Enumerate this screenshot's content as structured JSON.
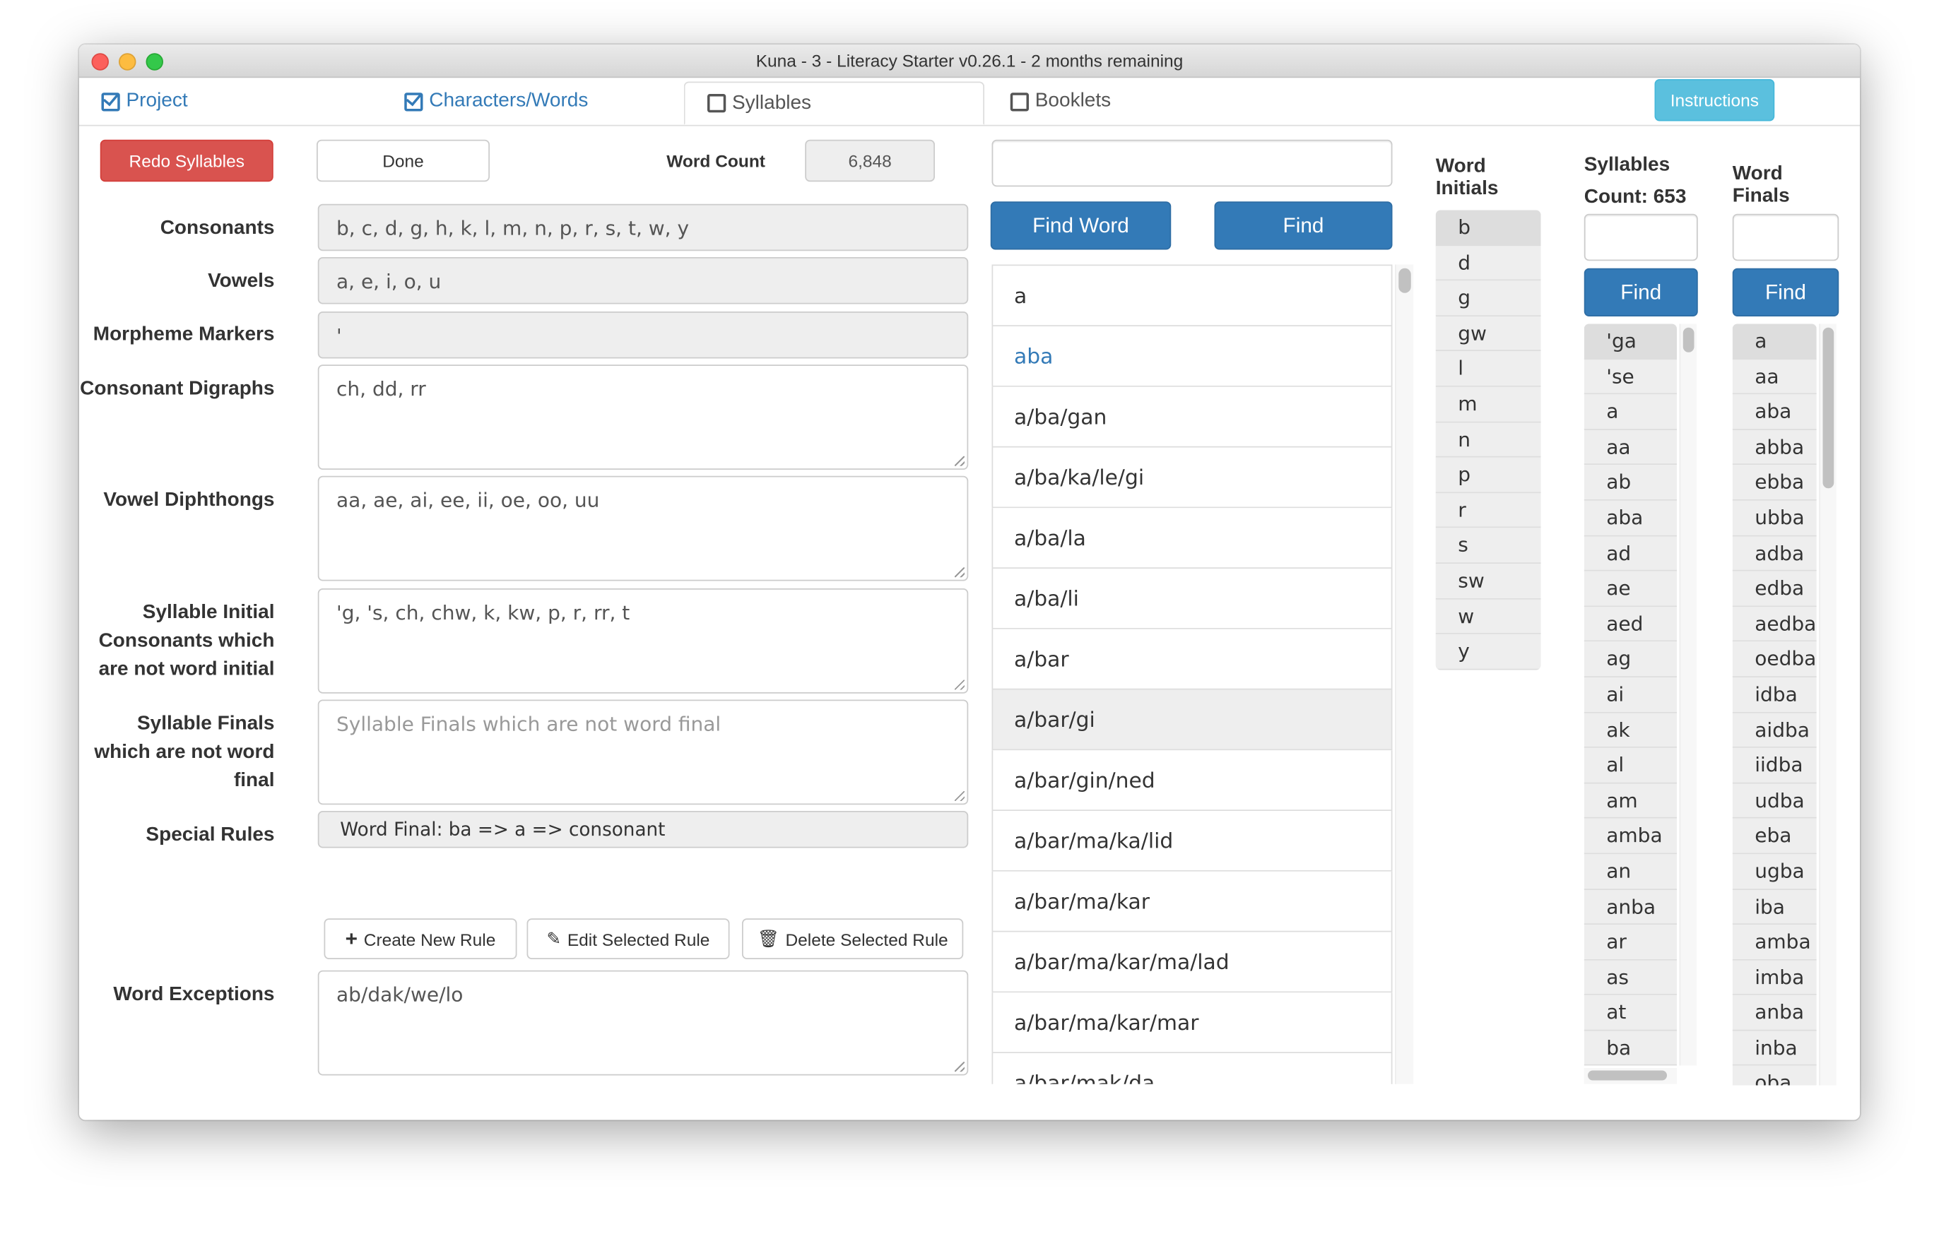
{
  "window": {
    "title": "Kuna - 3 - Literacy Starter v0.26.1 - 2 months remaining"
  },
  "tabs": [
    {
      "label": "Project",
      "checked": true
    },
    {
      "label": "Characters/Words",
      "checked": true
    },
    {
      "label": "Syllables",
      "checked": false,
      "active": true
    },
    {
      "label": "Booklets",
      "checked": false
    }
  ],
  "instructions_label": "Instructions",
  "toolbar": {
    "redo_label": "Redo Syllables",
    "done_label": "Done",
    "word_count_label": "Word Count",
    "word_count_value": "6,848"
  },
  "form": {
    "consonants": {
      "label": "Consonants",
      "value": "b, c, d, g, h, k, l, m, n, p, r, s, t, w, y"
    },
    "vowels": {
      "label": "Vowels",
      "value": "a, e, i, o, u"
    },
    "morpheme": {
      "label": "Morpheme Markers",
      "value": "'"
    },
    "digraphs": {
      "label": "Consonant Digraphs",
      "value": "ch, dd, rr"
    },
    "diphthongs": {
      "label": "Vowel Diphthongs",
      "value": "aa, ae, ai, ee, ii, oe, oo, uu"
    },
    "syl_initial": {
      "label": "Syllable Initial Consonants which are not word initial",
      "value": "'g, 's, ch, chw, k, kw, p, r, rr, t"
    },
    "syl_final": {
      "label": "Syllable Finals which are not word final",
      "placeholder": "Syllable Finals which are not word final",
      "value": ""
    },
    "special_rules": {
      "label": "Special Rules",
      "rule": "Word Final: ba => a => consonant"
    },
    "rule_buttons": {
      "create": "Create New Rule",
      "edit": "Edit Selected Rule",
      "delete": "Delete Selected Rule"
    },
    "exceptions": {
      "label": "Word Exceptions",
      "value": "ab/dak/we/lo"
    }
  },
  "words": {
    "search_value": "",
    "find_word_label": "Find Word",
    "find_label": "Find",
    "items": [
      "a",
      "aba",
      "a/ba/gan",
      "a/ba/ka/le/gi",
      "a/ba/la",
      "a/ba/li",
      "a/bar",
      "a/bar/gi",
      "a/bar/gin/ned",
      "a/bar/ma/ka/lid",
      "a/bar/ma/kar",
      "a/bar/ma/kar/ma/lad",
      "a/bar/ma/kar/mar",
      "a/bar/mak/da"
    ],
    "link_item": "aba",
    "selected_item": "a/bar/gi"
  },
  "word_initials": {
    "title": "Word Initials",
    "items": [
      "b",
      "d",
      "g",
      "gw",
      "l",
      "m",
      "n",
      "p",
      "r",
      "s",
      "sw",
      "w",
      "y"
    ],
    "selected_item": "b"
  },
  "syllables": {
    "title": "Syllables",
    "count_label": "Count: 653",
    "search_value": "",
    "find_label": "Find",
    "items": [
      "'ga",
      "'se",
      "a",
      "aa",
      "ab",
      "aba",
      "ad",
      "ae",
      "aed",
      "ag",
      "ai",
      "ak",
      "al",
      "am",
      "amba",
      "an",
      "anba",
      "ar",
      "as",
      "at",
      "ba"
    ],
    "selected_item": "'ga"
  },
  "word_finals": {
    "title": "Word Finals",
    "search_value": "",
    "find_label": "Find",
    "items": [
      "a",
      "aa",
      "aba",
      "abba",
      "ebba",
      "ubba",
      "adba",
      "edba",
      "aedba",
      "oedba",
      "idba",
      "aidba",
      "iidba",
      "udba",
      "eba",
      "ugba",
      "iba",
      "amba",
      "imba",
      "anba",
      "inba",
      "oba"
    ],
    "selected_item": "a"
  },
  "colors": {
    "primary": "#337ab7",
    "danger": "#d9534f",
    "info": "#5bc0de"
  }
}
